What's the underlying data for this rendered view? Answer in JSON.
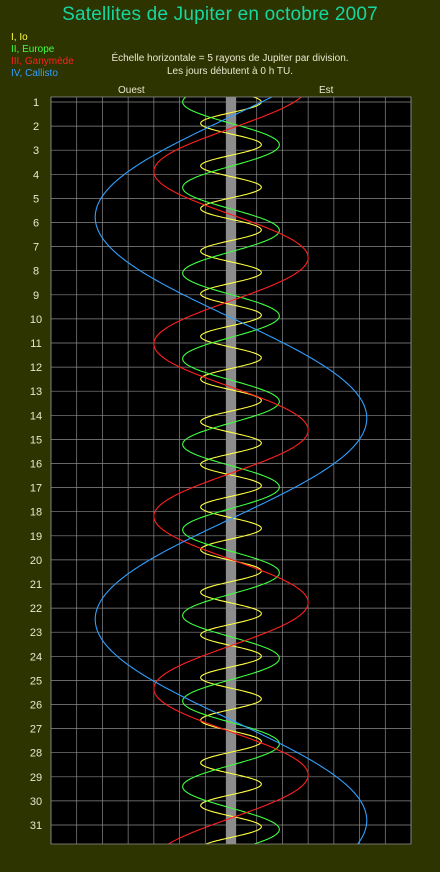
{
  "title": "Satellites de Jupiter en octobre 2007",
  "legend": [
    {
      "label": "I, Io",
      "color": "#ffff40"
    },
    {
      "label": "II, Europe",
      "color": "#40ff40"
    },
    {
      "label": "III, Ganymède",
      "color": "#ff2020"
    },
    {
      "label": "IV, Callisto",
      "color": "#30a0ff"
    }
  ],
  "notes": {
    "line1": "Échelle horizontale = 5 rayons de Jupiter par division.",
    "line2": "Les jours débutent à 0 h TU."
  },
  "directions": {
    "left": "Ouest",
    "right": "Est"
  },
  "chart_data": {
    "type": "line",
    "y_axis_ticks": [
      1,
      2,
      3,
      4,
      5,
      6,
      7,
      8,
      9,
      10,
      11,
      12,
      13,
      14,
      15,
      16,
      17,
      18,
      19,
      20,
      21,
      22,
      23,
      24,
      25,
      26,
      27,
      28,
      29,
      30,
      31
    ],
    "x_range_jupiter_radii": [
      -35,
      35
    ],
    "x_grid_step_jupiter_radii": 5,
    "grid": true,
    "series": [
      {
        "name": "I, Io",
        "color": "#ffff40",
        "amplitude_rj": 5.9,
        "period_days": 1.769,
        "ref_day": 1.0,
        "ref_phase_deg": 0
      },
      {
        "name": "II, Europe",
        "color": "#40ff40",
        "amplitude_rj": 9.4,
        "period_days": 3.551,
        "ref_day": 1.0,
        "ref_phase_deg": 180
      },
      {
        "name": "III, Ganymède",
        "color": "#ff2020",
        "amplitude_rj": 15.0,
        "period_days": 7.155,
        "ref_day": 1.0,
        "ref_phase_deg": 35
      },
      {
        "name": "IV, Callisto",
        "color": "#30a0ff",
        "amplitude_rj": 26.4,
        "period_days": 16.69,
        "ref_day": 1.0,
        "ref_phase_deg": 77
      }
    ]
  }
}
